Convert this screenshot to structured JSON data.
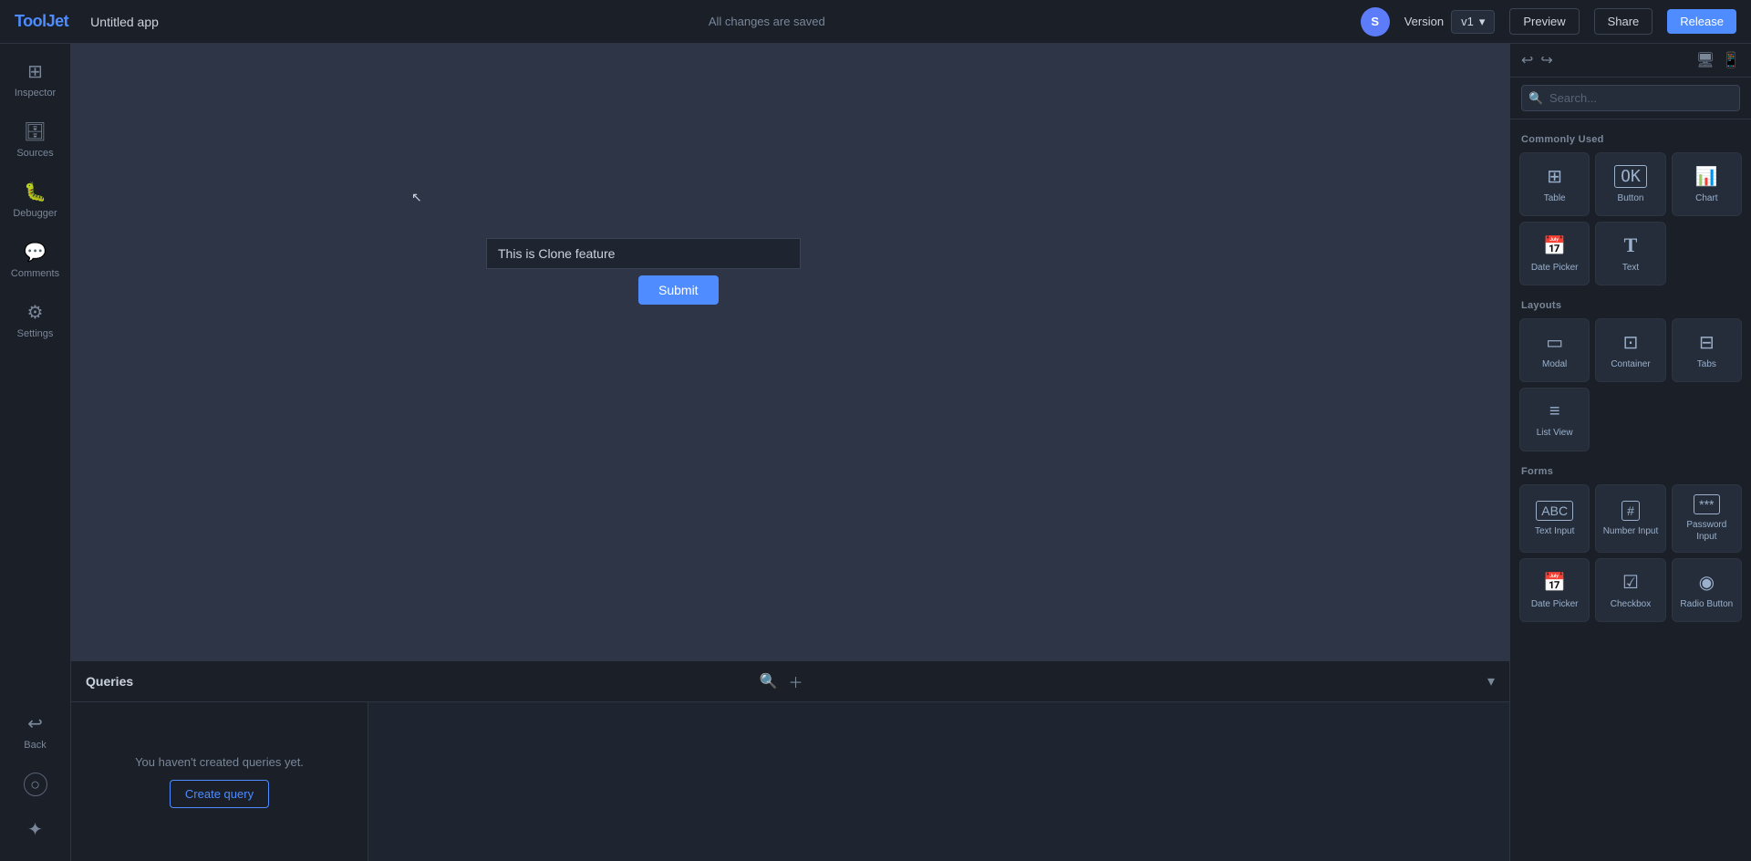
{
  "topbar": {
    "logo_t": "Tool",
    "logo_jet": "Jet",
    "app_title": "Untitled app",
    "save_status": "All changes are saved",
    "user_initial": "S",
    "version_label": "Version",
    "version_value": "v1",
    "preview_label": "Preview",
    "share_label": "Share",
    "release_label": "Release"
  },
  "sidebar": {
    "items": [
      {
        "id": "inspector",
        "icon": "⊞",
        "label": "Inspector"
      },
      {
        "id": "sources",
        "icon": "🗄",
        "label": "Sources"
      },
      {
        "id": "debugger",
        "icon": "🐛",
        "label": "Debugger"
      },
      {
        "id": "comments",
        "icon": "💬",
        "label": "Comments"
      },
      {
        "id": "settings",
        "icon": "⚙",
        "label": "Settings"
      }
    ],
    "bottom_items": [
      {
        "id": "back",
        "icon": "↩",
        "label": "Back"
      },
      {
        "id": "chat",
        "icon": "○",
        "label": ""
      },
      {
        "id": "theme",
        "icon": "✦",
        "label": ""
      }
    ]
  },
  "canvas": {
    "text_widget": "This is Clone feature",
    "button_widget": "Submit"
  },
  "query_panel": {
    "title": "Queries",
    "no_queries_text": "You haven't created queries yet.",
    "create_button": "Create query"
  },
  "right_sidebar": {
    "search_placeholder": "Search...",
    "sections": [
      {
        "id": "commonly_used",
        "label": "Commonly Used",
        "components": [
          {
            "id": "table",
            "icon": "⊞",
            "label": "Table"
          },
          {
            "id": "button",
            "icon": "▣",
            "label": "Button"
          },
          {
            "id": "chart",
            "icon": "📊",
            "label": "Chart"
          },
          {
            "id": "date-picker",
            "icon": "📅",
            "label": "Date Picker"
          },
          {
            "id": "text",
            "icon": "T",
            "label": "Text"
          }
        ]
      },
      {
        "id": "layouts",
        "label": "Layouts",
        "components": [
          {
            "id": "modal",
            "icon": "▭",
            "label": "Modal"
          },
          {
            "id": "container",
            "icon": "⊡",
            "label": "Container"
          },
          {
            "id": "tabs",
            "icon": "⊟",
            "label": "Tabs"
          },
          {
            "id": "list-view",
            "icon": "≡",
            "label": "List View"
          }
        ]
      },
      {
        "id": "forms",
        "label": "Forms",
        "components": [
          {
            "id": "text-input",
            "icon": "▭",
            "label": "Text Input"
          },
          {
            "id": "number-input",
            "icon": "#",
            "label": "Number Input"
          },
          {
            "id": "password-input",
            "icon": "***",
            "label": "Password Input"
          },
          {
            "id": "date-picker2",
            "icon": "📅",
            "label": "Date Picker"
          },
          {
            "id": "checkbox",
            "icon": "☑",
            "label": "Checkbox"
          },
          {
            "id": "radio-button",
            "icon": "◉",
            "label": "Radio Button"
          }
        ]
      }
    ]
  }
}
